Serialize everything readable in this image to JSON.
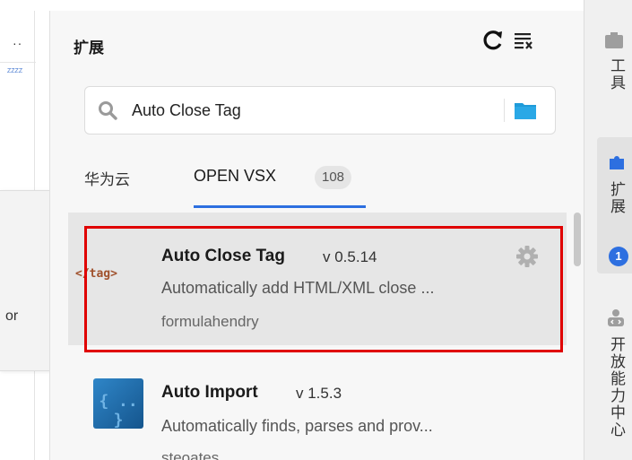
{
  "left": {
    "tab_dots": "··",
    "tab_tiny": "ZZZZ",
    "tooltip_text": "or"
  },
  "panel": {
    "title": "扩展",
    "refresh_icon": "refresh-icon",
    "clear_icon": "clear-all-icon"
  },
  "search": {
    "value": "Auto Close Tag",
    "placeholder": "",
    "icon": "search-icon",
    "folder_icon": "folder-icon"
  },
  "tabs": [
    {
      "label": "华为云"
    },
    {
      "label": "OPEN VSX",
      "count": "108",
      "active": true
    }
  ],
  "extensions": [
    {
      "name": "Auto Close Tag",
      "version": "v 0.5.14",
      "description": "Automatically add HTML/XML close ...",
      "author": "formulahendry",
      "icon": "tag-logo-icon",
      "icon_text": "</tag>",
      "selected": true
    },
    {
      "name": "Auto Import",
      "version": "v 1.5.3",
      "description": "Automatically finds, parses and prov...",
      "author": "steoates",
      "icon": "import-logo-icon",
      "icon_text": "{ .. }"
    }
  ],
  "right_bar": {
    "tools_label": "工具",
    "extensions_label": "扩展",
    "extensions_badge": "1",
    "open_capability_label": "开放能力中心"
  },
  "colors": {
    "accent": "#2d6fe0",
    "highlight_border": "#e00000",
    "selected_bg": "#e6e6e6",
    "folder": "#1f9bd9"
  }
}
